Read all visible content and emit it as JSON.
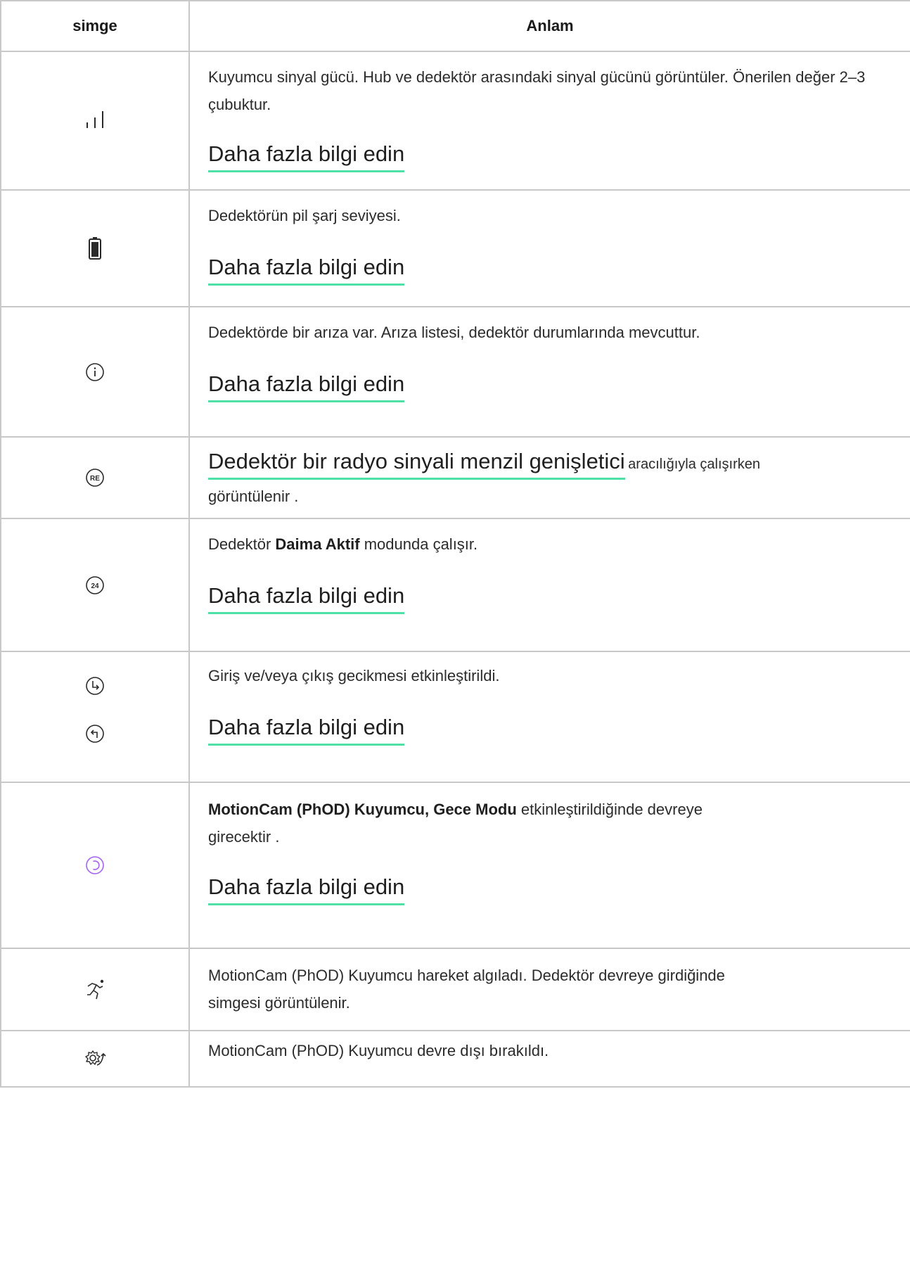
{
  "header": {
    "col_icon": "simge",
    "col_meaning": "Anlam"
  },
  "link_text": "Daha fazla bilgi edin",
  "rows": [
    {
      "icon": "signal-bars-icon",
      "desc": "Kuyumcu sinyal gücü. Hub ve dedektör arasındaki sinyal gücünü görüntüler. Önerilen değer 2–3 çubuktur."
    },
    {
      "icon": "battery-icon",
      "desc": "Dedektörün pil şarj seviyesi."
    },
    {
      "icon": "info-icon",
      "desc": "Dedektörde bir arıza var. Arıza listesi, dedektör durumlarında mevcuttur."
    },
    {
      "icon": "re-icon",
      "link": "Dedektör bir radyo sinyali menzil genişletici",
      "after": "aracılığıyla çalışırken",
      "line2": "görüntülenir ."
    },
    {
      "icon": "24h-icon",
      "prefix": "Dedektör ",
      "bold": "Daima Aktif",
      "suffix": " modunda çalışır."
    },
    {
      "icon": "delay-icons",
      "desc": "Giriş ve/veya çıkış gecikmesi etkinleştirildi."
    },
    {
      "icon": "night-mode-icon",
      "bold": "MotionCam (PhOD) Kuyumcu, Gece Modu",
      "suffix": " etkinleştirildiğinde devreye",
      "line2": "girecektir ."
    },
    {
      "icon": "motion-detected-icon",
      "desc": "MotionCam (PhOD) Kuyumcu hareket algıladı. Dedektör devreye girdiğinde",
      "line2": "simgesi görüntülenir."
    },
    {
      "icon": "disarmed-gear-icon",
      "desc": "MotionCam (PhOD) Kuyumcu devre dışı bırakıldı."
    }
  ],
  "colors": {
    "accent_underline": "#4fe0a8",
    "night_mode": "#a463f2",
    "border": "#c8c8c8"
  }
}
